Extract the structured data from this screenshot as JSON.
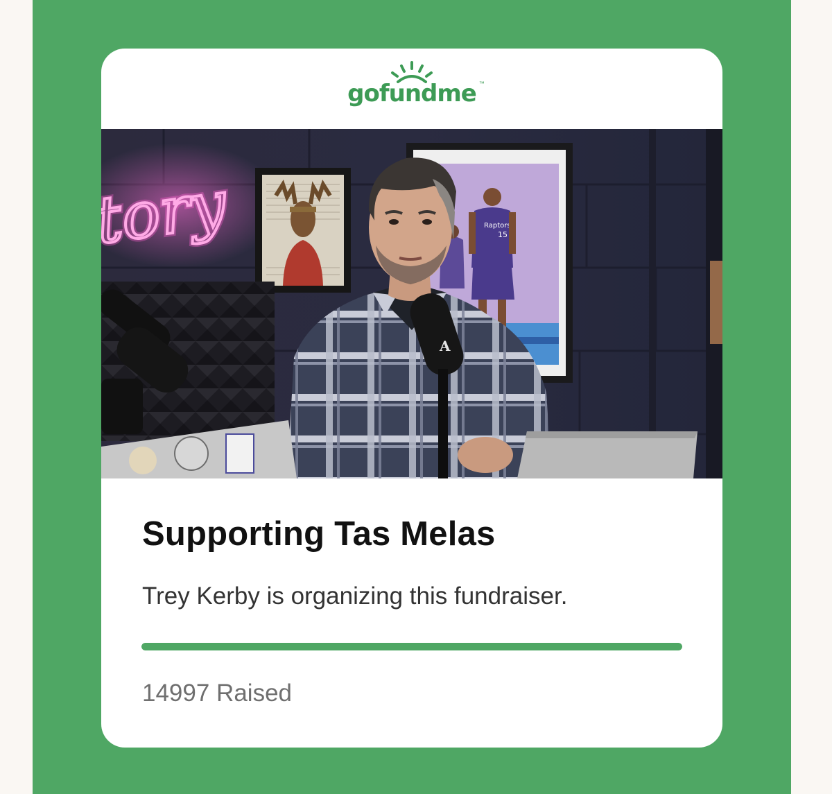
{
  "brand": {
    "logo_text": "gofundme",
    "trademark": "™",
    "color": "#3d9b55"
  },
  "background": {
    "panel_color": "#4fa764",
    "page_color": "#faf7f3"
  },
  "hero_image": {
    "neon_text": "tory",
    "mic_badge": "A",
    "jersey_number": "15",
    "jersey_text": "Raptors"
  },
  "fundraiser": {
    "title": "Supporting Tas Melas",
    "organizer_line": "Trey Kerby is organizing this fundraiser.",
    "raised_label": "14997 Raised",
    "progress_fraction": 1.0
  }
}
